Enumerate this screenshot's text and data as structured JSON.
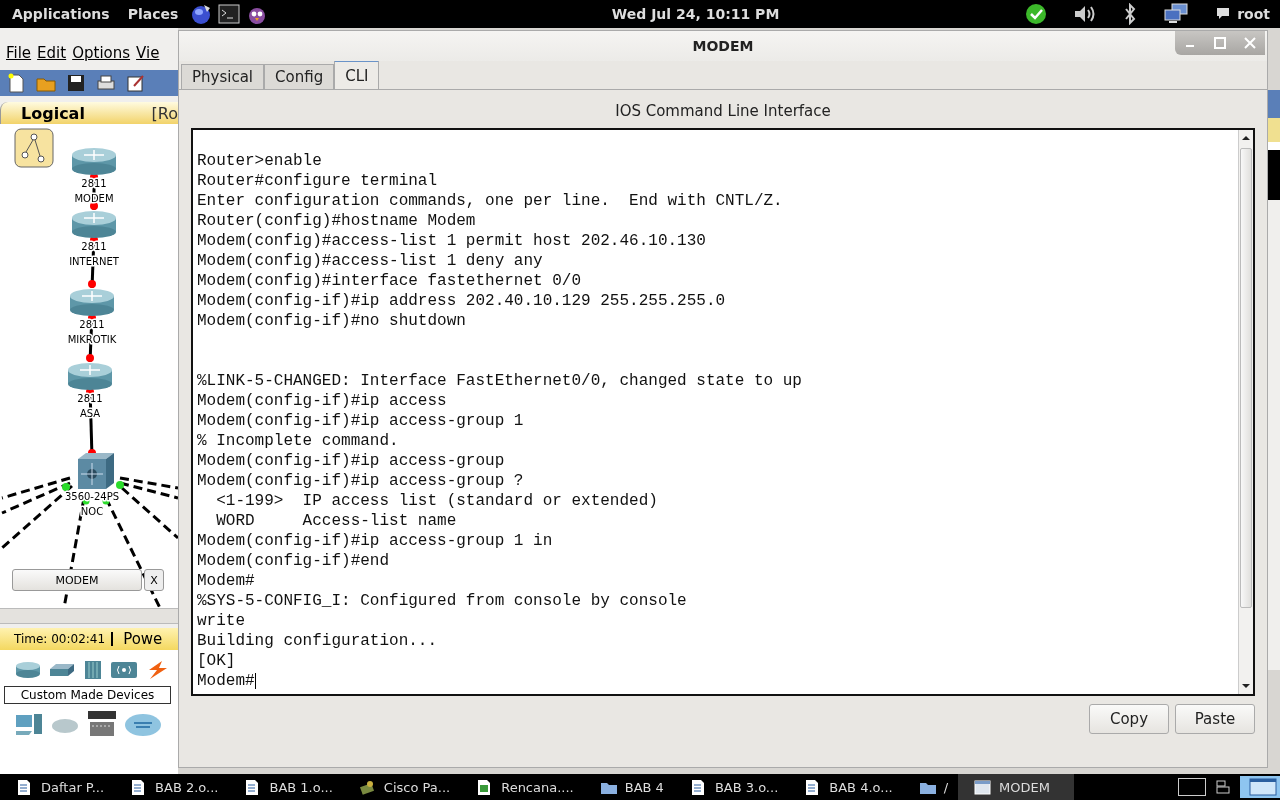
{
  "top_panel": {
    "menus": [
      "Applications",
      "Places"
    ],
    "clock": "Wed Jul 24, 10:11 PM",
    "user": "root"
  },
  "background_app": {
    "menus": [
      "File",
      "Edit",
      "Options",
      "Vie"
    ],
    "workspace_tab": "Logical",
    "workspace_path": "[Ro",
    "devices": [
      {
        "model": "2811",
        "name": "MODEM"
      },
      {
        "model": "2811",
        "name": "INTERNET"
      },
      {
        "model": "2811",
        "name": "MIKROTIK"
      },
      {
        "model": "2811",
        "name": "ASA"
      }
    ],
    "switch": {
      "model": "3560-24PS",
      "name": "NOC"
    },
    "pdu_button": "MODEM",
    "pdu_close": "X",
    "time": "Time: 00:02:41",
    "mode": "Powe",
    "device_category": "Custom Made Devices"
  },
  "dialog": {
    "title": "MODEM",
    "tabs": [
      {
        "label": "Physical",
        "selected": false
      },
      {
        "label": "Config",
        "selected": false
      },
      {
        "label": "CLI",
        "selected": true
      }
    ],
    "heading": "IOS Command Line Interface",
    "output_blocks": [
      [
        "Router>enable",
        "Router#configure terminal",
        "Enter configuration commands, one per line.  End with CNTL/Z.",
        "Router(config)#hostname Modem",
        "Modem(config)#access-list 1 permit host 202.46.10.130",
        "Modem(config)#access-list 1 deny any",
        "Modem(config)#interface fastethernet 0/0",
        "Modem(config-if)#ip address 202.40.10.129 255.255.255.0",
        "Modem(config-if)#no shutdown"
      ],
      [
        "%LINK-5-CHANGED: Interface FastEthernet0/0, changed state to up",
        "Modem(config-if)#ip access",
        "Modem(config-if)#ip access-group 1",
        "% Incomplete command.",
        "Modem(config-if)#ip access-group",
        "Modem(config-if)#ip access-group ?",
        "  <1-199>  IP access list (standard or extended)",
        "  WORD     Access-list name",
        "Modem(config-if)#ip access-group 1 in",
        "Modem(config-if)#end",
        "Modem#",
        "%SYS-5-CONFIG_I: Configured from console by console",
        "write",
        "Building configuration...",
        "[OK]",
        "Modem#"
      ]
    ],
    "buttons": [
      "Copy",
      "Paste"
    ]
  },
  "taskbar": {
    "items": [
      {
        "label": "Daftar P...",
        "kind": "document",
        "selected": false
      },
      {
        "label": "BAB 2.o...",
        "kind": "document",
        "selected": false
      },
      {
        "label": "BAB 1.o...",
        "kind": "document",
        "selected": false
      },
      {
        "label": "Cisco Pa...",
        "kind": "app",
        "selected": false
      },
      {
        "label": "Rencana....",
        "kind": "spreadsheet",
        "selected": false
      },
      {
        "label": "BAB 4",
        "kind": "folder",
        "selected": false
      },
      {
        "label": "BAB 3.o...",
        "kind": "document",
        "selected": false
      },
      {
        "label": "BAB 4.o...",
        "kind": "document",
        "selected": false
      },
      {
        "label": "/",
        "kind": "folder",
        "selected": false
      },
      {
        "label": "MODEM",
        "kind": "window",
        "selected": true
      }
    ]
  }
}
